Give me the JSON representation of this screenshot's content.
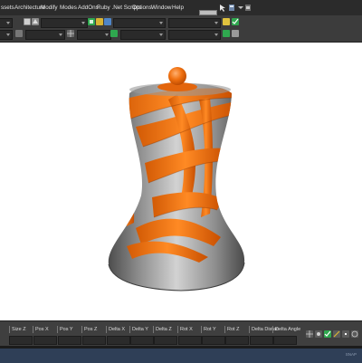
{
  "menu": {
    "items": [
      "ssets",
      "Architecture",
      "Modify",
      "Modes",
      "AddOns",
      "Ruby .Net Scripts",
      "Options",
      "Window",
      "Help"
    ]
  },
  "viewport": {
    "model": "twisted-vase",
    "colors": {
      "body": "#a9a9a9",
      "stripes": "#ff7a12",
      "knob": "#f06a10",
      "background": "#ffffff"
    }
  },
  "statusbar": {
    "fields": [
      "Size Z",
      "Pos X",
      "Pos Y",
      "Pos Z",
      "Delta X",
      "Delta Y",
      "Delta Z",
      "Rot X",
      "Rot Y",
      "Rot Z",
      "Delta Distan",
      "Delta Angle"
    ],
    "corner_label": "SNAP"
  },
  "colors": {
    "menubar": "#2b2b2b",
    "toolbar": "#3c3c3c",
    "statusbar": "#3f3f3f",
    "accent": "#2fa84f"
  }
}
